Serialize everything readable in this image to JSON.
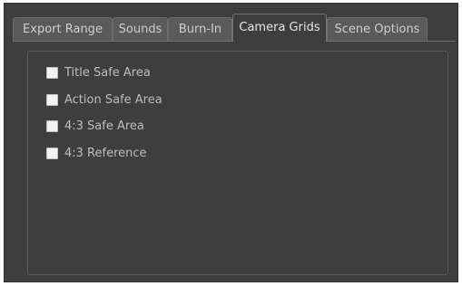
{
  "tabs": [
    {
      "label": "Export Range"
    },
    {
      "label": "Sounds"
    },
    {
      "label": "Burn-In"
    },
    {
      "label": "Camera Grids",
      "active": true
    },
    {
      "label": "Scene Options"
    }
  ],
  "camera_grids": {
    "options": [
      {
        "label": "Title Safe Area",
        "checked": false
      },
      {
        "label": "Action Safe Area",
        "checked": false
      },
      {
        "label": "4:3 Safe Area",
        "checked": false
      },
      {
        "label": "4:3 Reference",
        "checked": false
      }
    ]
  }
}
